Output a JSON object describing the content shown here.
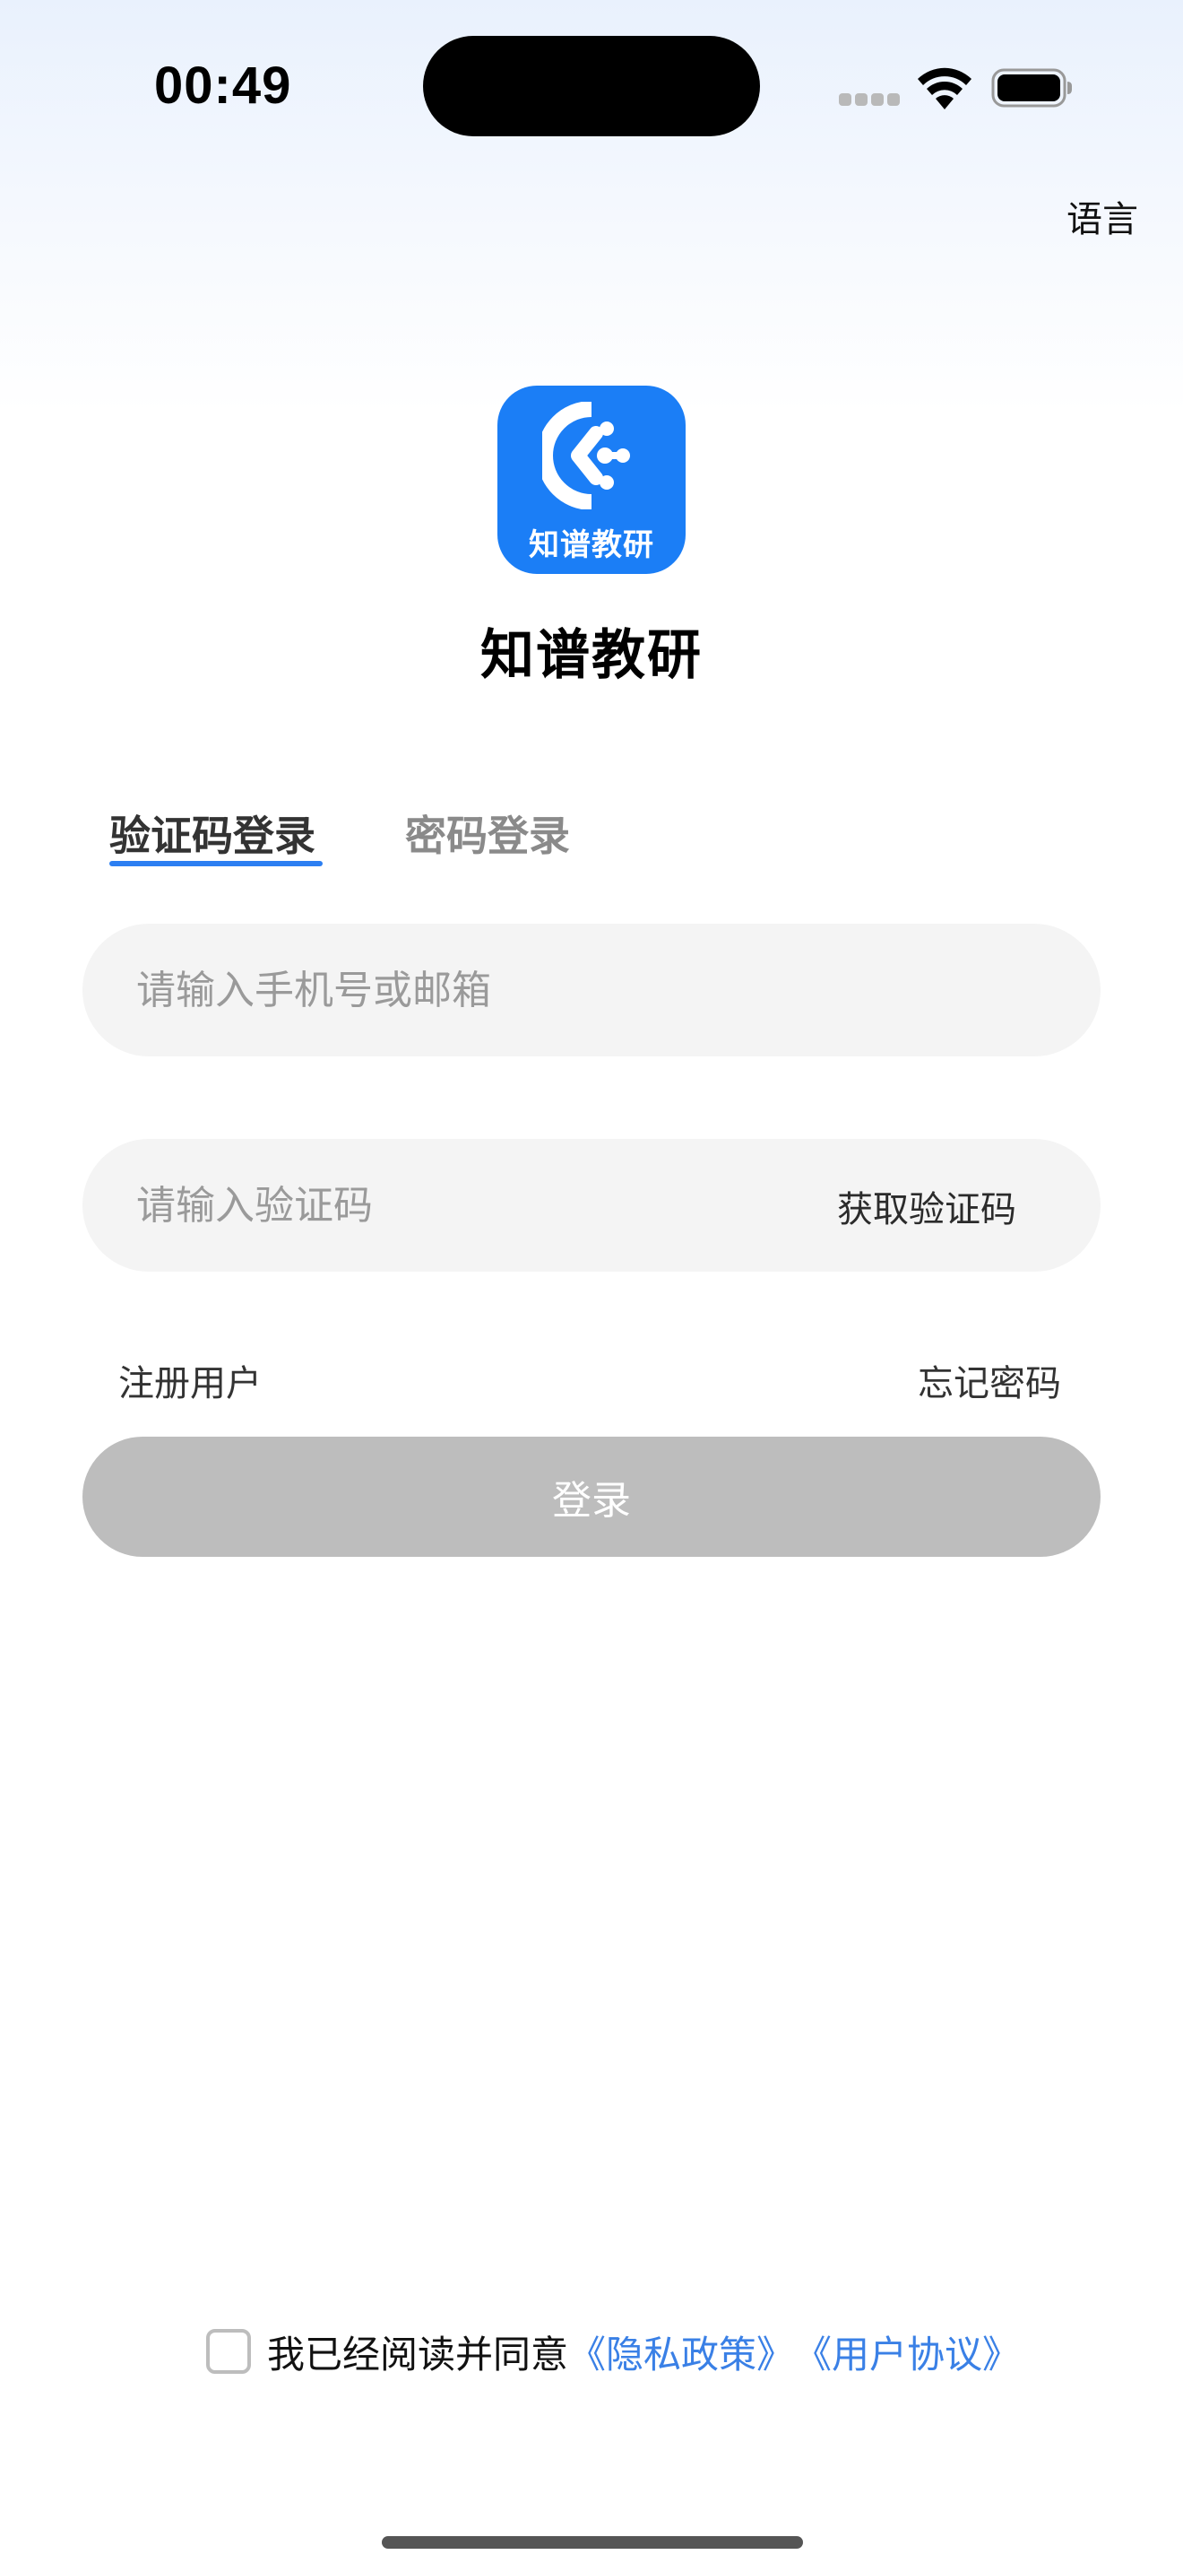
{
  "status_bar": {
    "time": "00:49"
  },
  "header": {
    "language_label": "语言"
  },
  "app": {
    "logo_text": "知谱教研",
    "name": "知谱教研",
    "brand_color": "#1b7ef6"
  },
  "tabs": [
    {
      "label": "验证码登录",
      "active": true
    },
    {
      "label": "密码登录",
      "active": false
    }
  ],
  "form": {
    "account_placeholder": "请输入手机号或邮箱",
    "account_value": "",
    "code_placeholder": "请输入验证码",
    "code_value": "",
    "get_code_label": "获取验证码"
  },
  "links": {
    "register": "注册用户",
    "forgot_password": "忘记密码"
  },
  "login_button": {
    "label": "登录",
    "enabled": false,
    "color": "#bdbdbd"
  },
  "agreement": {
    "checked": false,
    "text": "我已经阅读并同意",
    "privacy_link": "《隐私政策》",
    "terms_link": "《用户协议》",
    "link_color": "#3a80e6"
  }
}
